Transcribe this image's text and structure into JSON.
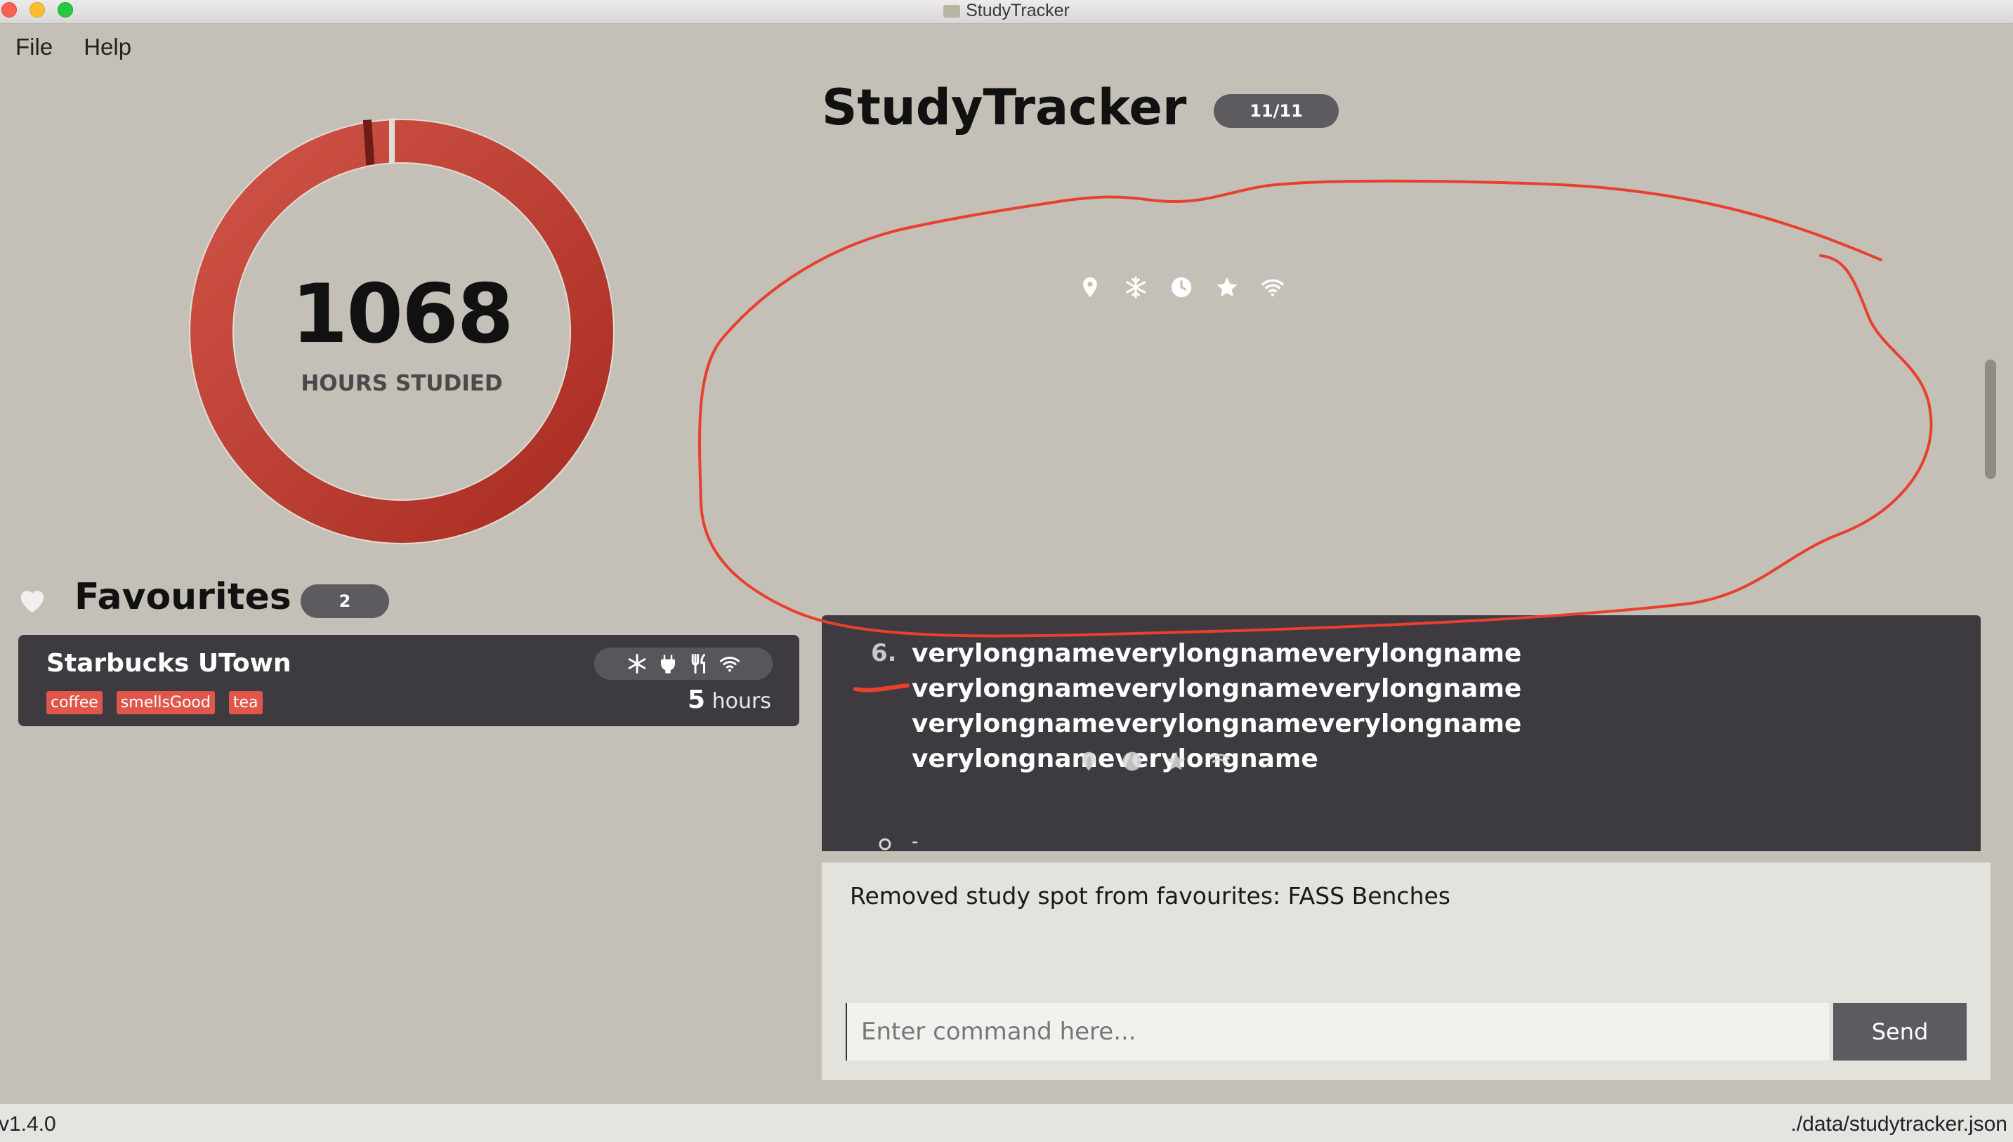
{
  "window": {
    "title": "StudyTracker"
  },
  "menu": {
    "items": [
      "File",
      "Help"
    ]
  },
  "overview": {
    "hours_value": "1068",
    "hours_label": "HOURS STUDIED",
    "ring_colors": {
      "main": "#b8342a",
      "light": "#cf5446",
      "accent": "#7a1e18"
    }
  },
  "header": {
    "title": "StudyTracker",
    "count": "11/11"
  },
  "selected_spot": {
    "amenity_icons": [
      "location-pin-icon",
      "snowflake-icon",
      "clock-icon",
      "star-icon",
      "wifi-icon"
    ]
  },
  "favourites": {
    "title": "Favourites",
    "count": "2",
    "items": [
      {
        "name": "Starbucks UTown",
        "amenity_icons": [
          "snowflake-icon",
          "plug-icon",
          "utensils-icon",
          "wifi-icon"
        ],
        "tags": [
          "coffee",
          "smellsGood",
          "tea"
        ],
        "hours": "5",
        "hours_unit": "hours"
      }
    ]
  },
  "spot_list": {
    "items": [
      {
        "index": "6.",
        "name": "verylongnameverylongnameverylongnameverylongnameverylongnameverylongnameverylongnameverylongnameverylongnameverylongnameverylongname",
        "amenity_icons": [
          "location-pin-icon",
          "clock-icon",
          "star-icon",
          "wifi-icon"
        ],
        "address": "-"
      }
    ]
  },
  "result": {
    "message": "Removed study spot from favourites: FASS Benches"
  },
  "command": {
    "placeholder": "Enter command here...",
    "value": "",
    "send_label": "Send"
  },
  "status": {
    "version": "v1.4.0",
    "data_path": "./data/studytracker.json"
  },
  "colors": {
    "background": "#c4c0b8",
    "panel_dark": "#3d3a40",
    "pill": "#5d5a60",
    "tag": "#e0564b",
    "annotation": "#e8402e"
  }
}
